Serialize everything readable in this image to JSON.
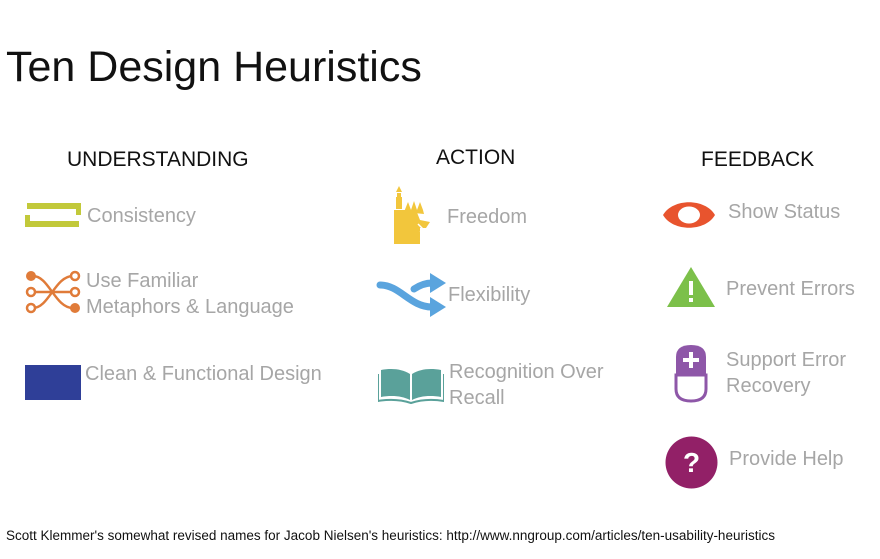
{
  "title": "Ten Design Heuristics",
  "columns": [
    {
      "heading": "UNDERSTANDING",
      "items": [
        {
          "label": "Consistency",
          "icon": "consistency-icon"
        },
        {
          "label_line1": "Use Familiar",
          "label_line2": "Metaphors & Language",
          "icon": "crossed-arrows-icon"
        },
        {
          "label": "Clean & Functional Design",
          "icon": "blue-rectangle-icon"
        }
      ]
    },
    {
      "heading": "ACTION",
      "items": [
        {
          "label": "Freedom",
          "icon": "statue-of-liberty-icon"
        },
        {
          "label": "Flexibility",
          "icon": "swap-arrows-icon"
        },
        {
          "label_line1": "Recognition Over",
          "label_line2": "Recall",
          "icon": "open-book-icon"
        }
      ]
    },
    {
      "heading": "FEEDBACK",
      "items": [
        {
          "label": "Show Status",
          "icon": "eye-icon"
        },
        {
          "label": "Prevent Errors",
          "icon": "warning-triangle-icon"
        },
        {
          "label_line1": "Support Error",
          "label_line2": "Recovery",
          "icon": "eraser-plus-icon"
        },
        {
          "label": "Provide Help",
          "icon": "question-circle-icon"
        }
      ]
    }
  ],
  "footer": "Scott Klemmer's somewhat revised names for Jacob Nielsen's heuristics: http://www.nngroup.com/articles/ten-usability-heuristics",
  "colors": {
    "consistency": "#c2c93a",
    "metaphors": "#e07b39",
    "clean": "#2f3f98",
    "freedom": "#f2c63c",
    "flexibility": "#5aa4de",
    "recognition": "#5aa19a",
    "status": "#e8542e",
    "errors": "#7cc04a",
    "recovery": "#8e57a8",
    "help": "#922067"
  }
}
